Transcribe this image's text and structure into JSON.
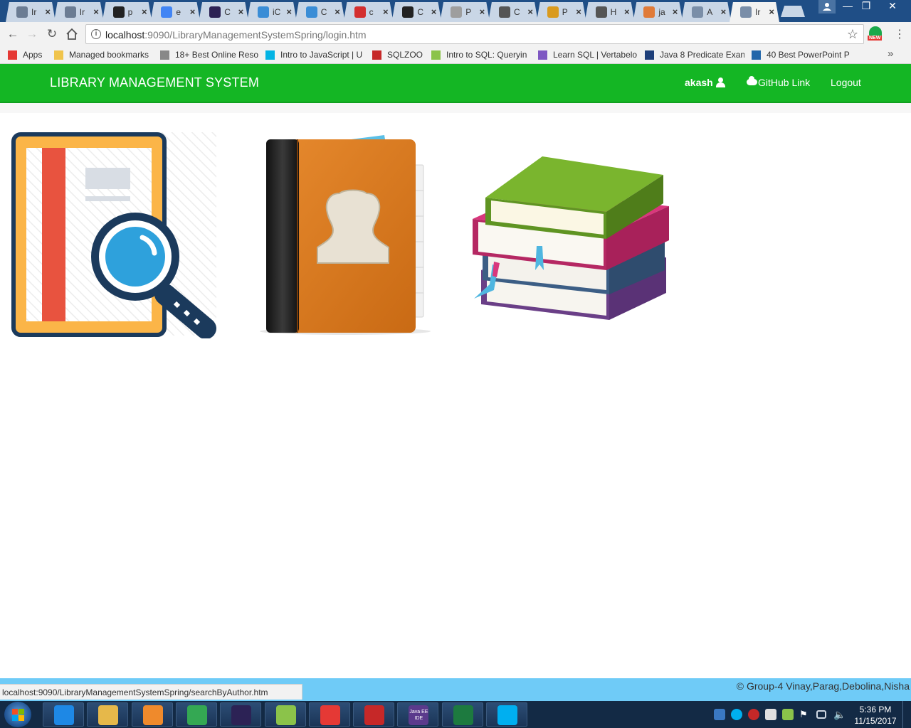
{
  "browser": {
    "tabs": [
      {
        "title": "Ir",
        "icon": "loading-icon",
        "color": "#6b7c93"
      },
      {
        "title": "Ir",
        "icon": "loading-icon",
        "color": "#6b7c93"
      },
      {
        "title": "p",
        "icon": "github-icon",
        "color": "#222222"
      },
      {
        "title": "e",
        "icon": "google-icon",
        "color": "#4285f4"
      },
      {
        "title": "C",
        "icon": "eclipse-icon",
        "color": "#2c2255"
      },
      {
        "title": "iC",
        "icon": "puzzle-icon",
        "color": "#3a8dd6"
      },
      {
        "title": "C",
        "icon": "puzzle-icon",
        "color": "#3a8dd6"
      },
      {
        "title": "c",
        "icon": "oracle-icon",
        "color": "#d32f2f"
      },
      {
        "title": "C",
        "icon": "github-icon",
        "color": "#222222"
      },
      {
        "title": "P",
        "icon": "page-icon",
        "color": "#9e9e9e"
      },
      {
        "title": "C",
        "icon": "wikipedia-icon",
        "color": "#555555"
      },
      {
        "title": "P",
        "icon": "stackoverflow-icon",
        "color": "#d99a1e"
      },
      {
        "title": "H",
        "icon": "t-icon",
        "color": "#555555"
      },
      {
        "title": "ja",
        "icon": "java-icon",
        "color": "#e07b39"
      },
      {
        "title": "A",
        "icon": "puzzle-icon",
        "color": "#7a8ea8"
      },
      {
        "title": "Ir",
        "icon": "page-icon",
        "color": "#7a8ea8",
        "active": true
      }
    ],
    "address": {
      "host": "localhost",
      "rest": ":9090/LibraryManagementSystemSpring/login.htm"
    },
    "bookmarks": [
      {
        "label": "Apps",
        "icon": "apps-grid-icon",
        "color": "#e53935"
      },
      {
        "label": "Managed bookmarks",
        "icon": "folder-icon",
        "color": "#f0c44c"
      },
      {
        "label": "18+ Best Online Reso",
        "icon": "page-icon",
        "color": "#888888"
      },
      {
        "label": "Intro to JavaScript | U",
        "icon": "udacity-icon",
        "color": "#02b3e4"
      },
      {
        "label": "SQLZOO",
        "icon": "sqlzoo-icon",
        "color": "#c62828"
      },
      {
        "label": "Intro to SQL: Queryin",
        "icon": "leaf-icon",
        "color": "#8bc34a"
      },
      {
        "label": "Learn SQL | Vertabelo",
        "icon": "vertabelo-icon",
        "color": "#7e57c2"
      },
      {
        "label": "Java 8 Predicate Exan",
        "icon": "p-circle-icon",
        "color": "#1e3f7a"
      },
      {
        "label": "40 Best PowerPoint P",
        "icon": "pp-icon",
        "color": "#2266aa"
      }
    ]
  },
  "app": {
    "brand": "LIBRARY MANAGEMENT SYSTEM",
    "user": "akash",
    "github": "GitHub Link",
    "logout": "Logout",
    "header_color": "#14b624",
    "footer_color": "#6fcbf7",
    "tiles": [
      {
        "name": "search-book-tile",
        "icon": "magnifier-book-icon"
      },
      {
        "name": "address-book-tile",
        "icon": "contact-book-icon"
      },
      {
        "name": "book-stack-tile",
        "icon": "books-stack-icon"
      }
    ],
    "copyright": "© Group-4 Vinay,Parag,Debolina,Nisha"
  },
  "status_url": "localhost:9090/LibraryManagementSystemSpring/searchByAuthor.htm",
  "taskbar": {
    "apps": [
      {
        "name": "internet-explorer",
        "icon": "ie-icon",
        "color": "#1e88e5"
      },
      {
        "name": "file-explorer",
        "icon": "folder-icon",
        "color": "#e6b84a"
      },
      {
        "name": "media-player",
        "icon": "media-player-icon",
        "color": "#ef8a2c"
      },
      {
        "name": "chrome",
        "icon": "chrome-icon",
        "color": "#34a853"
      },
      {
        "name": "eclipse",
        "icon": "eclipse-icon",
        "color": "#2c2255"
      },
      {
        "name": "notepad-plus-plus",
        "icon": "notepad-icon",
        "color": "#8bc34a"
      },
      {
        "name": "sourcetree",
        "icon": "diamond-icon",
        "color": "#e53935"
      },
      {
        "name": "star-app",
        "icon": "star-icon",
        "color": "#c62828"
      },
      {
        "name": "java-ee-ide",
        "icon": "java-ee-ide-icon",
        "color": "#5b3a8c",
        "label": "Java EE IDE"
      },
      {
        "name": "excel",
        "icon": "excel-icon",
        "color": "#1d7a3f"
      },
      {
        "name": "skype",
        "icon": "skype-icon",
        "color": "#00aff0"
      }
    ],
    "time": "5:36 PM",
    "date": "11/15/2017"
  }
}
